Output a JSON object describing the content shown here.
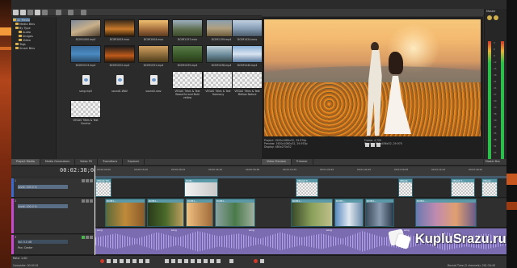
{
  "app": {
    "colors": {
      "accent": "#5c99a8",
      "audio": "#7b6bb0",
      "meter_green": "#2bbf4a",
      "panel": "#2d2d2d"
    }
  },
  "toolbar": {
    "preview_quality": "Best (Full)",
    "icons": [
      "import-icon",
      "capture-icon",
      "refresh-icon",
      "views-icon",
      "delete-icon",
      "play-icon"
    ]
  },
  "explorer": {
    "items": [
      {
        "label": "All Media",
        "selected": true
      },
      {
        "label": "Media Bins"
      },
      {
        "label": "By Type"
      },
      {
        "label": "Audio"
      },
      {
        "label": "Images"
      },
      {
        "label": "Video"
      },
      {
        "label": "Tags"
      },
      {
        "label": "Smart Bins"
      }
    ]
  },
  "media": {
    "items": [
      {
        "name": "DCIM1000.mp4"
      },
      {
        "name": "DCIM1003.mov"
      },
      {
        "name": "DCIM1004.mov"
      },
      {
        "name": "DCIM1157.mov"
      },
      {
        "name": "DCIM1159.mp4"
      },
      {
        "name": "DCIM1424.mov"
      },
      {
        "name": "DCIM1013.mp4"
      },
      {
        "name": "DCIM1022.mp4"
      },
      {
        "name": "DCIM1031.mp4"
      },
      {
        "name": "DCIM1035.mp4"
      },
      {
        "name": "DCIM1038.mp4"
      },
      {
        "name": "DCIM1040.mp4"
      },
      {
        "name": "song.mp3"
      },
      {
        "name": "sound1.WAV"
      },
      {
        "name": "sound2.wav"
      },
      {
        "name": "VEGAS Titles & Text Beautiful and Bold yellow"
      },
      {
        "name": "VEGAS Titles & Text Harmony"
      },
      {
        "name": "VEGAS Titles & Text Mellow Nature"
      },
      {
        "name": "VEGAS Titles & Text Sunrise"
      }
    ]
  },
  "dock_tabs": [
    "Project Media",
    "Media Generators",
    "Video FX",
    "Transitions",
    "Explorer"
  ],
  "preview": {
    "info_left": [
      "Project:   1920x1080x32, 29.970p",
      "Preview:   1920x1080x32, 29.970p",
      "Display:   480x270x32"
    ],
    "info_right": [
      "Frame:   4,700",
      "Display:   812x456x32, 29.970"
    ],
    "tabs": [
      "Video Preview",
      "Trimmer"
    ]
  },
  "master": {
    "title": "Master",
    "tab": "Master Bus",
    "scale": [
      "3",
      "6",
      "9",
      "12",
      "15",
      "18",
      "21",
      "24",
      "27",
      "30",
      "33",
      "36",
      "39",
      "42",
      "45",
      "48",
      "51",
      "54"
    ]
  },
  "timeline": {
    "timecode": "00:02:38;08",
    "ruler": [
      "00:00:00;00",
      "00:00:15;00",
      "00:00:29;29",
      "00:00:44;29",
      "00:00:59;28",
      "00:01:14;29",
      "00:01:29;29",
      "00:01:44;29",
      "00:01:59;28",
      "00:02:14;29",
      "00:02:29;29"
    ],
    "tracks": [
      {
        "num": "1",
        "label": "Level: 100.0 %"
      },
      {
        "num": "2",
        "label": "Level: 100.0 %"
      },
      {
        "num": "3",
        "label": "Vol:  0.0 dB",
        "pan": "Pan:  Center"
      }
    ],
    "clips_top": [
      "VEGAS Titl...",
      "DCIM...",
      "VEGAS Ti...",
      "VEGAS",
      "VEGAS T...",
      "VEGAS"
    ],
    "clips_video": [
      "DCIM1...",
      "DCIM1...",
      "DCIM1...",
      "DCIM1...",
      "DCIM1...",
      "DCIM1...",
      "DCIM1...",
      "DCIM1..."
    ],
    "audio_clips": [
      "song",
      "song",
      "song",
      "song",
      "song"
    ]
  },
  "bottom": {
    "rate": "Rate: 1.00",
    "status": "Complete: 00:00:01",
    "record_time": "Record Time (2 channels): 201:34:45"
  },
  "watermark": {
    "text": "KupluSrazu.ru"
  }
}
